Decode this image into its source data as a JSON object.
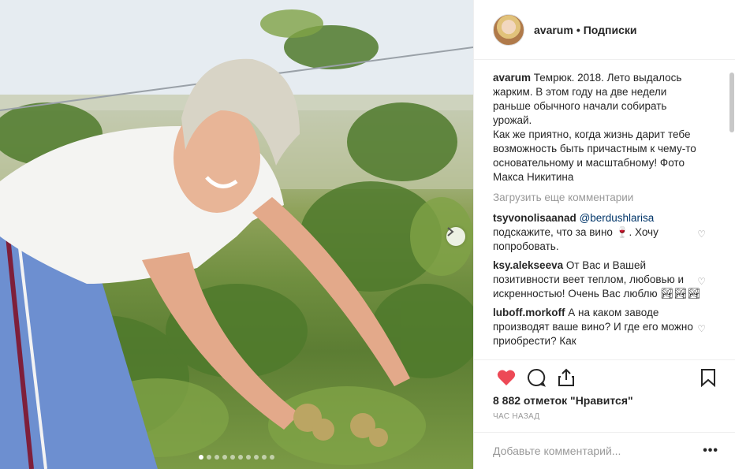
{
  "header": {
    "username": "avarum",
    "separator": "•",
    "follow_status": "Подписки"
  },
  "caption": {
    "username": "avarum",
    "text": "Темрюк. 2018. Лето выдалось жарким. В этом году на две недели раньше обычного начали собирать урожай.",
    "text2": "Как же приятно, когда жизнь дарит тебе возможность быть причастным к чему-то основательному и масштабному! Фото Макса Никитина"
  },
  "load_more": "Загрузить еще комментарии",
  "comments": [
    {
      "username": "tsyvonolisaanad",
      "mention": "@berdushlarisa",
      "text": "подскажите, что за вино 🍷. Хочу попробовать."
    },
    {
      "username": "ksy.alekseeva",
      "mention": "",
      "text": "От Вас и Вашей позитивности веет теплом, любовью и искренностью! Очень Вас люблю 🏞🏞🏞"
    },
    {
      "username": "luboff.morkoff",
      "mention": "",
      "text": "А на каком заводе производят ваше вино? И где его можно приобрести? Как"
    }
  ],
  "likes": "8 882 отметок \"Нравится\"",
  "time": "час назад",
  "add_comment_placeholder": "Добавьте комментарий...",
  "more_label": "•••",
  "carousel": {
    "total": 10,
    "active": 1
  },
  "colors": {
    "like_red": "#ed4956",
    "link": "#003569",
    "muted": "#999999"
  },
  "icons": {
    "like": "heart-icon",
    "comment": "comment-icon",
    "share": "share-icon",
    "save": "bookmark-icon",
    "next": "chevron-right-icon",
    "comment_like": "heart-outline-icon"
  }
}
